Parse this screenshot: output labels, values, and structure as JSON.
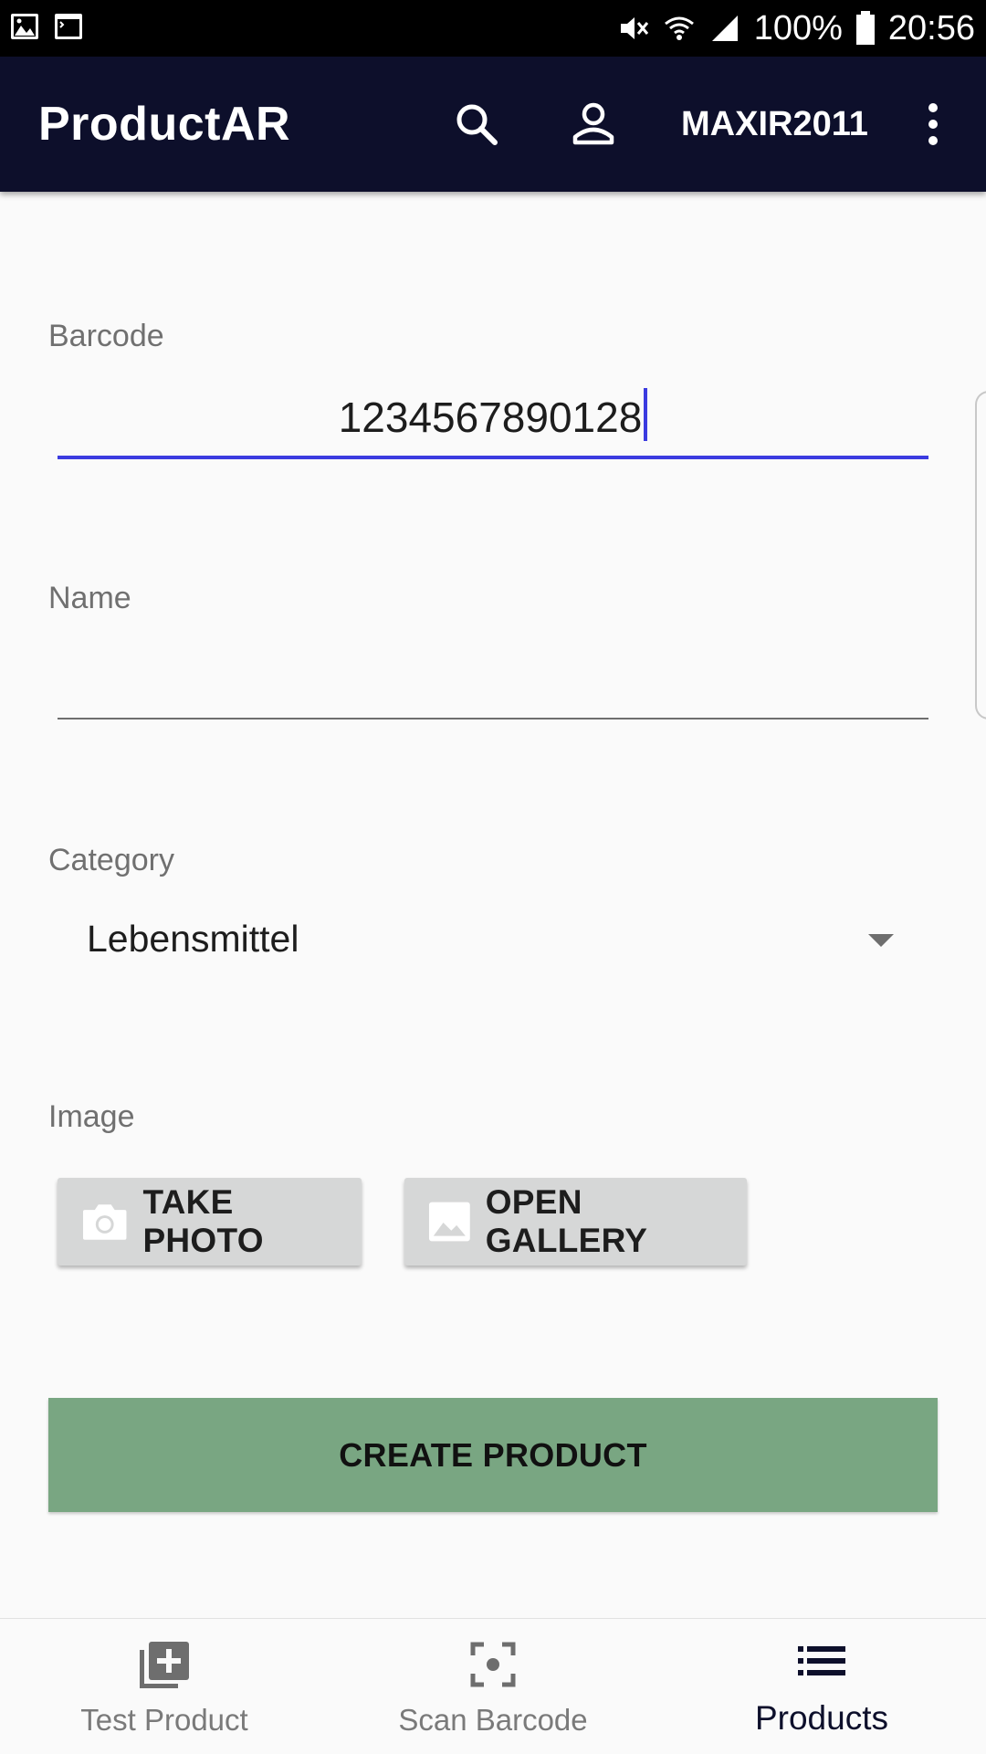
{
  "status_bar": {
    "battery": "100%",
    "time": "20:56"
  },
  "app_bar": {
    "title": "ProductAR",
    "username": "MAXIR2011"
  },
  "form": {
    "barcode": {
      "label": "Barcode",
      "value": "1234567890128"
    },
    "name": {
      "label": "Name",
      "value": ""
    },
    "category": {
      "label": "Category",
      "selected": "Lebensmittel"
    },
    "image": {
      "label": "Image",
      "take_photo_label": "TAKE PHOTO",
      "open_gallery_label": "OPEN GALLERY"
    },
    "create_label": "CREATE PRODUCT"
  },
  "bottom_nav": {
    "items": [
      {
        "label": "Test Product",
        "icon": "add-to-library-icon"
      },
      {
        "label": "Scan Barcode",
        "icon": "center-focus-icon"
      },
      {
        "label": "Products",
        "icon": "list-icon"
      }
    ],
    "active_index": 2
  },
  "colors": {
    "app_bar": "#0d0f2b",
    "accent": "#3b3be0",
    "create_button": "#79a682",
    "image_button": "#d6d7d7"
  }
}
